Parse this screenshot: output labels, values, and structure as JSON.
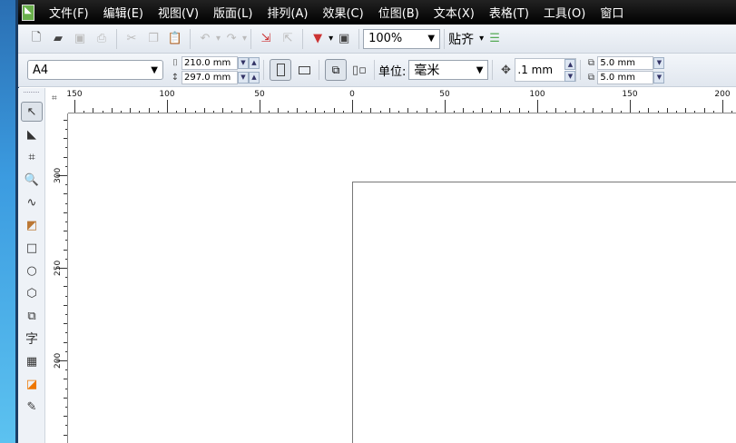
{
  "menu": [
    "文件(F)",
    "编辑(E)",
    "视图(V)",
    "版面(L)",
    "排列(A)",
    "效果(C)",
    "位图(B)",
    "文本(X)",
    "表格(T)",
    "工具(O)",
    "窗口"
  ],
  "toolbar": {
    "zoom": "100%",
    "snap": "贴齐"
  },
  "property_bar": {
    "page_size": "A4",
    "width": "210.0 mm",
    "height": "297.0 mm",
    "unit_label": "单位:",
    "unit": "毫米",
    "nudge": ".1 mm",
    "dup_x": "5.0 mm",
    "dup_y": "5.0 mm"
  },
  "ruler": {
    "top_labels": [
      "150",
      "100",
      "50",
      "0",
      "50",
      "100",
      "150",
      "200"
    ],
    "left_labels": [
      "300",
      "250",
      "200"
    ]
  }
}
